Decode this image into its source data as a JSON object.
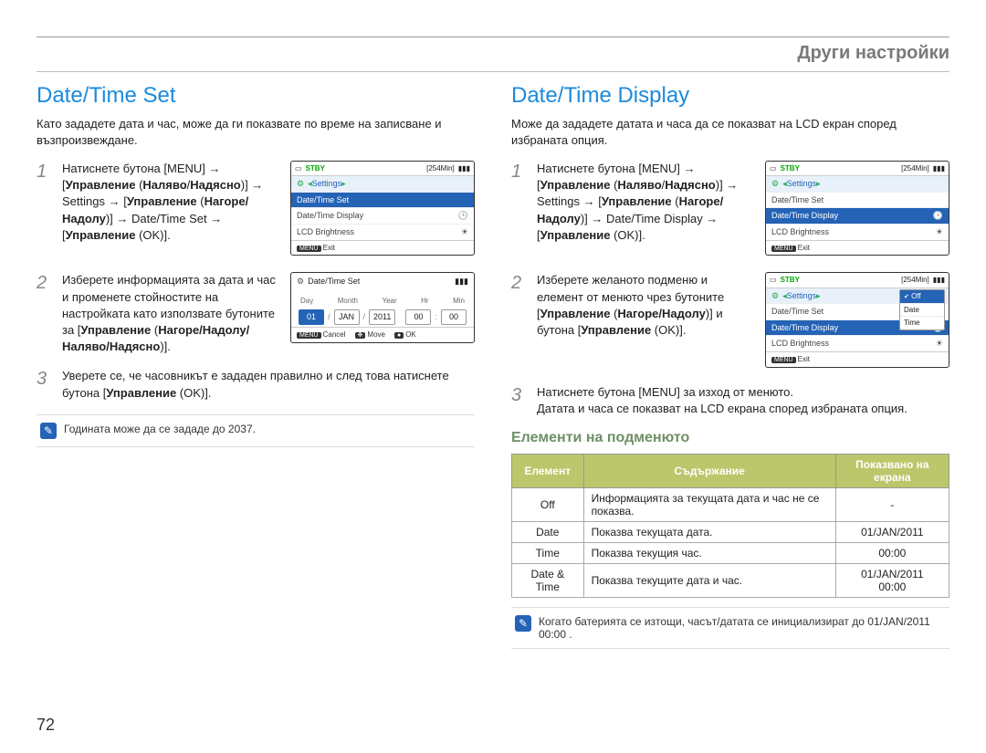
{
  "header": {
    "title": "Други настройки"
  },
  "left": {
    "heading": "Date/Time Set",
    "intro": "Като зададете дата и час, може да ги показвате по време на записване и възпроизвеждане.",
    "step1": "Натиснете бутона [MENU] → [Управление (Наляво/Надясно)] → Settings → [Управление (Нагоре/Надолу)] → Date/Time Set → [Управление (OK)].",
    "step2": "Изберете информацията за дата и час и променете стойностите на настройката като използвате бутоните за [Управление (Нагоре/Надолу/Наляво/Надясно)].",
    "step3": "Уверете се, че часовникът е зададен правилно и след това натиснете бутона [Управление (OK)].",
    "note": "Годината може да се зададе до 2037.",
    "lcd1": {
      "status": "STBY",
      "time": "[254Min]",
      "crumb": "Settings",
      "rows": [
        "Date/Time Set",
        "Date/Time Display",
        "LCD Brightness"
      ],
      "selected": 0,
      "foot_exit": "Exit"
    },
    "lcd2": {
      "title": "Date/Time Set",
      "labels": [
        "Day",
        "Month",
        "Year",
        "Hr",
        "Min"
      ],
      "values": [
        "01",
        "JAN",
        "2011",
        "00",
        "00"
      ],
      "foot_cancel": "Cancel",
      "foot_move": "Move",
      "foot_ok": "OK"
    }
  },
  "right": {
    "heading": "Date/Time Display",
    "intro": "Може да зададете датата и часа да се показват на LCD екран според избраната опция.",
    "step1": "Натиснете бутона [MENU] → [Управление (Наляво/Надясно)] → Settings → [Управление (Нагоре/Надолу)] → Date/Time Display → [Управление (OK)].",
    "step2": "Изберете желаното подменю и елемент от менюто чрез бутоните [Управление (Нагоре/Надолу)] и бутона [Управление (OK)].",
    "step3": "Натиснете бутона [MENU] за изход от менюто.\nДатата и часа се показват на LCD екрана според избраната опция.",
    "lcd1": {
      "status": "STBY",
      "time": "[254Min]",
      "crumb": "Settings",
      "rows": [
        "Date/Time Set",
        "Date/Time Display",
        "LCD Brightness"
      ],
      "selected": 1,
      "foot_exit": "Exit"
    },
    "lcd2": {
      "status": "STBY",
      "time": "[254Min]",
      "crumb": "Settings",
      "rows": [
        "Date/Time Set",
        "Date/Time Display",
        "LCD Brightness"
      ],
      "popup": [
        "Off",
        "Date",
        "Time"
      ],
      "popup_selected": 0,
      "foot_exit": "Exit"
    },
    "subhead": "Елементи на подменюто",
    "table": {
      "headers": [
        "Елемент",
        "Съдържание",
        "Показвано на екрана"
      ],
      "rows": [
        {
          "el": "Off",
          "desc": "Информацията за текущата дата и час не се показва.",
          "disp": "-"
        },
        {
          "el": "Date",
          "desc": "Показва текущата дата.",
          "disp": "01/JAN/2011"
        },
        {
          "el": "Time",
          "desc": "Показва текущия час.",
          "disp": "00:00"
        },
        {
          "el": "Date & Time",
          "desc": "Показва текущите дата и час.",
          "disp": "01/JAN/2011\n00:00"
        }
      ]
    },
    "note": "Когато батерията се изтощи, часът/датата се инициализират до 01/JAN/2011 00:00 ."
  },
  "page_number": "72"
}
